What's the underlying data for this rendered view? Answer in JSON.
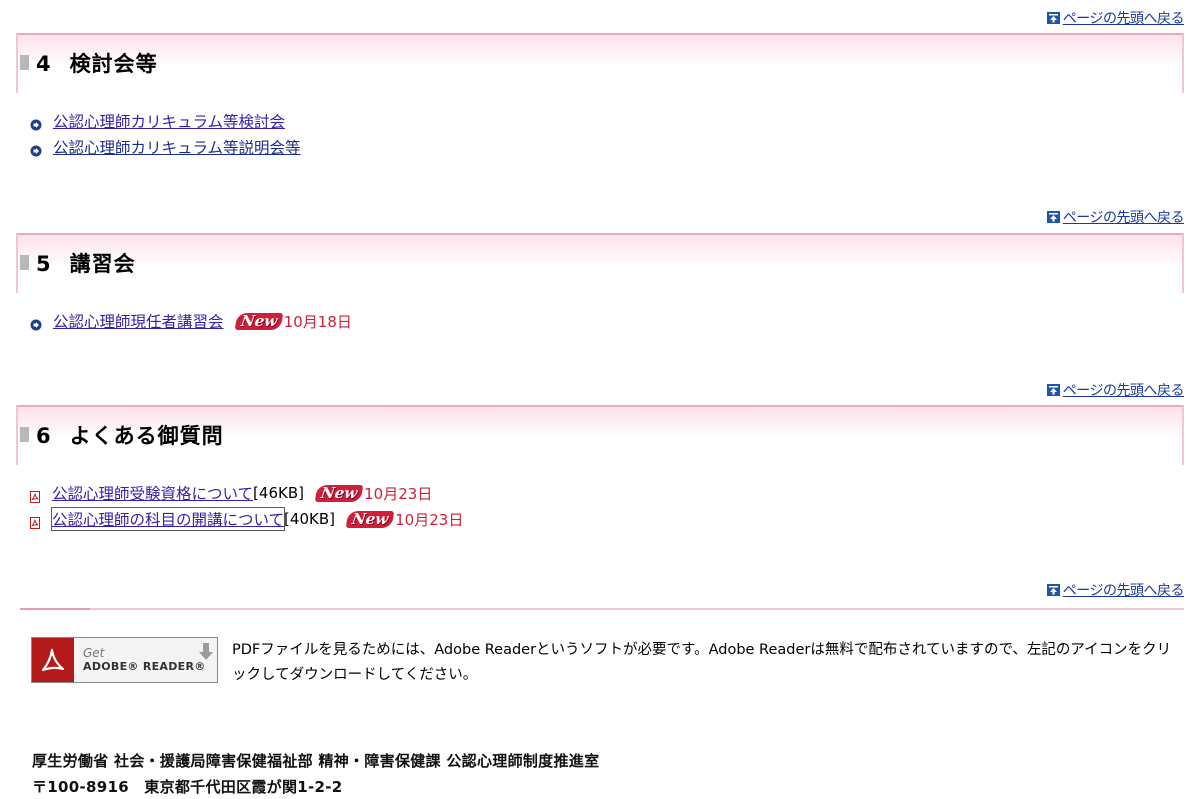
{
  "back_to_top_label": "ページの先頭へ戻る",
  "sections": [
    {
      "number": "4",
      "title": "検討会等",
      "items": [
        {
          "label": "公認心理師カリキュラム等検討会"
        },
        {
          "label": "公認心理師カリキュラム等説明会等"
        }
      ]
    },
    {
      "number": "5",
      "title": "講習会",
      "items": [
        {
          "label": "公認心理師現任者講習会",
          "badge": "New",
          "date": "10月18日"
        }
      ]
    },
    {
      "number": "6",
      "title": "よくある御質問",
      "items": [
        {
          "label": "公認心理師受験資格について",
          "size": "[46KB]",
          "badge": "New",
          "date": "10月23日"
        },
        {
          "label": "公認心理師の科目の開講について",
          "size": "[40KB]",
          "badge": "New",
          "date": "10月23日"
        }
      ]
    }
  ],
  "adobe": {
    "get": "Get",
    "reader": "ADOBE® READER®",
    "note": "PDFファイルを見るためには、Adobe Readerというソフトが必要です。Adobe Readerは無料で配布されていますので、左記のアイコンをクリックしてダウンロードしてください。"
  },
  "footer": {
    "department": "厚生労働省 社会・援護局障害保健福祉部 精神・障害保健課 公認心理師制度推進室",
    "address": "〒100-8916　東京都千代田区霞が関1-2-2"
  },
  "colors": {
    "link": "#3a1ea8",
    "new_badge": "#d01f3a",
    "date": "#d0203a",
    "section_border": "#e8a9be"
  }
}
